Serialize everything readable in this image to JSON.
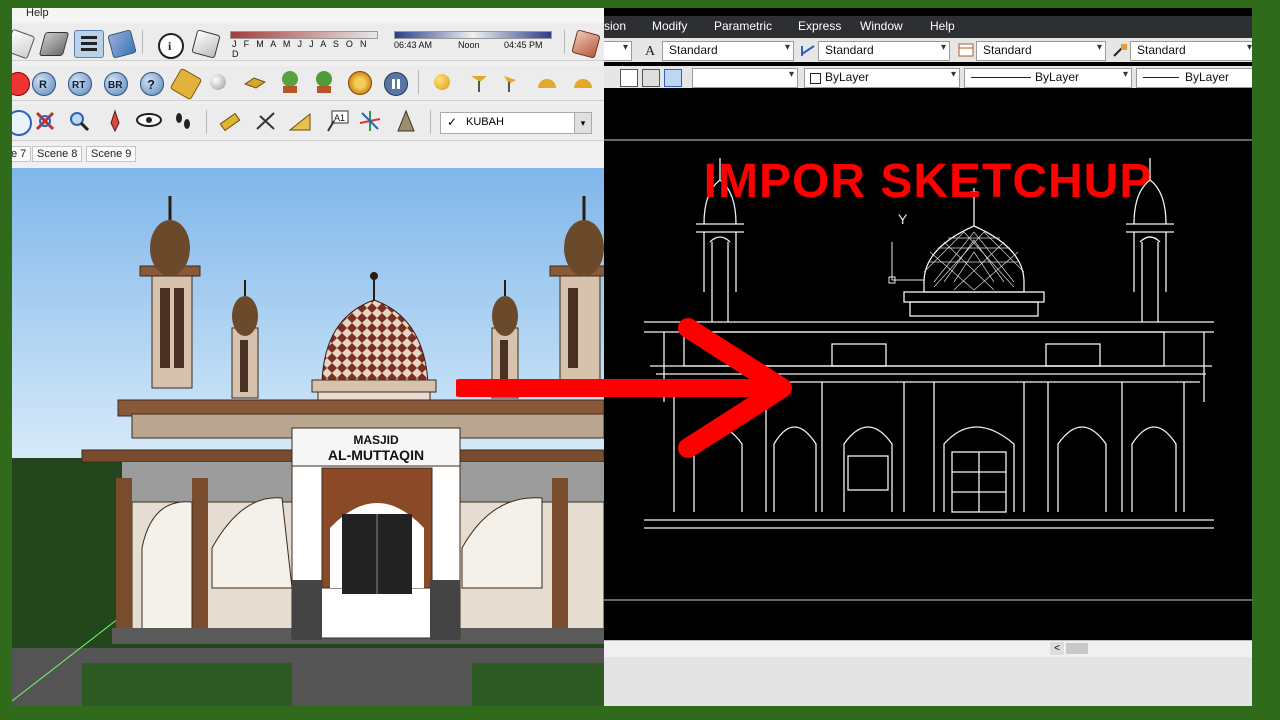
{
  "sketchup": {
    "menu_label": "Help",
    "toolbar_icons": [
      "select-icon",
      "eraser-icon",
      "layers-icon",
      "paint-icon",
      "info-icon",
      "components-icon",
      "shadow-settings-icon",
      "r-icon",
      "rt-icon",
      "br-icon",
      "help-icon",
      "tag-icon",
      "sphere-icon",
      "bird-icon",
      "tree-icon",
      "tree2-icon",
      "target-icon",
      "pause-icon",
      "sun-icon",
      "flag-icon",
      "measure-icon",
      "zoom-icon",
      "orbit-icon",
      "walk-icon",
      "eye-icon",
      "footprints-icon",
      "tape-icon",
      "dimension-icon",
      "protractor-icon",
      "text-icon",
      "axes-icon",
      "section-icon"
    ],
    "shadow_months": "J F M A M J J A S O N D",
    "time_start": "06:43 AM",
    "time_noon": "Noon",
    "time_end": "04:45 PM",
    "layer_value": "KUBAH",
    "scene_tabs": [
      "e 7",
      "Scene 8",
      "Scene 9"
    ],
    "sign_line1": "MASJID",
    "sign_line2": "AL-MUTTAQIN"
  },
  "autocad": {
    "menu": [
      "sion",
      "Modify",
      "Parametric",
      "Express",
      "Window",
      "Help"
    ],
    "style_dropdowns": [
      "Standard",
      "Standard",
      "Standard",
      "Standard"
    ],
    "layer_dropdowns": [
      "ByLayer",
      "ByLayer",
      "ByLayer"
    ],
    "scroll_left": "<",
    "ucs_y_label": "Y"
  },
  "overlay": {
    "title": "IMPOR SKETCHUP",
    "title_color": "#ff0000",
    "arrow_color": "#ff0000",
    "frame_color": "#2f6b1a"
  }
}
